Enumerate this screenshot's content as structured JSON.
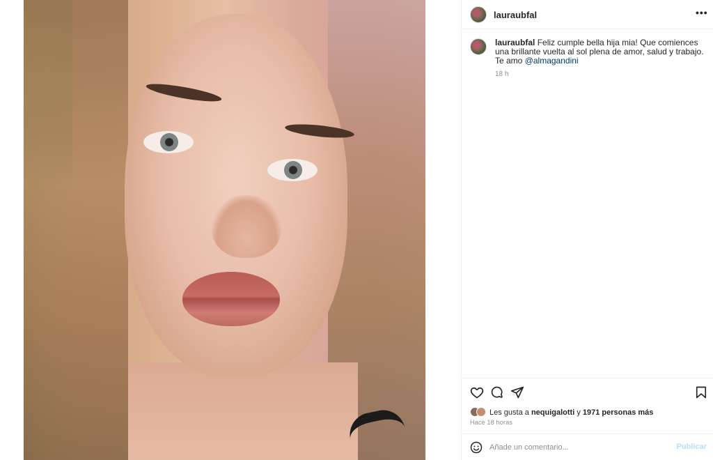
{
  "post": {
    "username": "lauraubfal",
    "menu_icon": "more-horizontal-icon",
    "image_alt": "selfie-photo"
  },
  "caption": {
    "username": "lauraubfal",
    "text": " Feliz cumple bella hija mia! Que comiences una brillante vuelta al sol plena de amor, salud y trabajo. Te amo ",
    "mention": "@almagandini",
    "time": "18 h"
  },
  "actions": {
    "like_icon": "heart-icon",
    "comment_icon": "comment-icon",
    "share_icon": "send-icon",
    "save_icon": "bookmark-icon"
  },
  "likes": {
    "prefix": "Les gusta a ",
    "user": "nequigalotti",
    "middle": " y ",
    "others": "1971 personas más",
    "time": "Hace 18 horas"
  },
  "comment": {
    "emoji_icon": "smiley-icon",
    "placeholder": "Añade un comentario...",
    "publish_label": "Publicar"
  },
  "colors": {
    "mention": "#00376b",
    "muted": "#8e8e8e",
    "publish_disabled": "#b2dffc",
    "border": "#efefef"
  }
}
